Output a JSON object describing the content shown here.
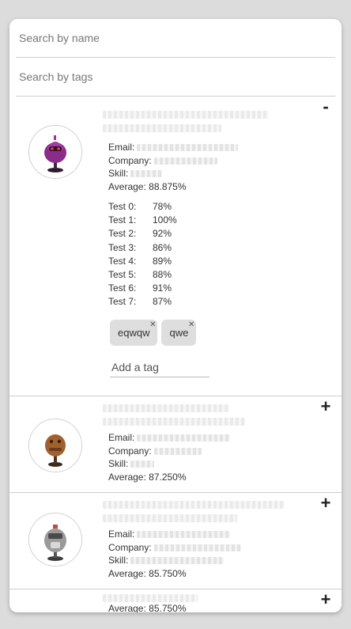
{
  "search": {
    "name_placeholder": "Search by name",
    "tags_placeholder": "Search by tags"
  },
  "labels": {
    "email": "Email:",
    "company": "Company:",
    "skill": "Skill:",
    "average_prefix": "Average: "
  },
  "students": [
    {
      "toggle": "-",
      "name_text": "ZZZZZZZZZZZZZZZZ",
      "avatar": "purple-robot-avatar",
      "average": "88.875%",
      "expanded": true,
      "grades": [
        {
          "label": "Test 0:",
          "value": "78%"
        },
        {
          "label": "Test 1:",
          "value": "100%"
        },
        {
          "label": "Test 2:",
          "value": "92%"
        },
        {
          "label": "Test 3:",
          "value": "86%"
        },
        {
          "label": "Test 4:",
          "value": "89%"
        },
        {
          "label": "Test 5:",
          "value": "88%"
        },
        {
          "label": "Test 6:",
          "value": "91%"
        },
        {
          "label": "Test 7:",
          "value": "87%"
        }
      ],
      "tags": [
        "eqwqw",
        "qwe"
      ],
      "tag_placeholder": "Add a tag"
    },
    {
      "toggle": "+",
      "name_text": "ZZZZZZZZZZZZ",
      "avatar": "brown-robot-avatar",
      "average": "87.250%",
      "expanded": false
    },
    {
      "toggle": "+",
      "name_text": "ZZZZZZZZZZZZZZZZZZ",
      "avatar": "gray-robot-avatar",
      "average": "85.750%",
      "expanded": false
    },
    {
      "toggle": "+",
      "average": "85.750%",
      "expanded": false
    }
  ]
}
